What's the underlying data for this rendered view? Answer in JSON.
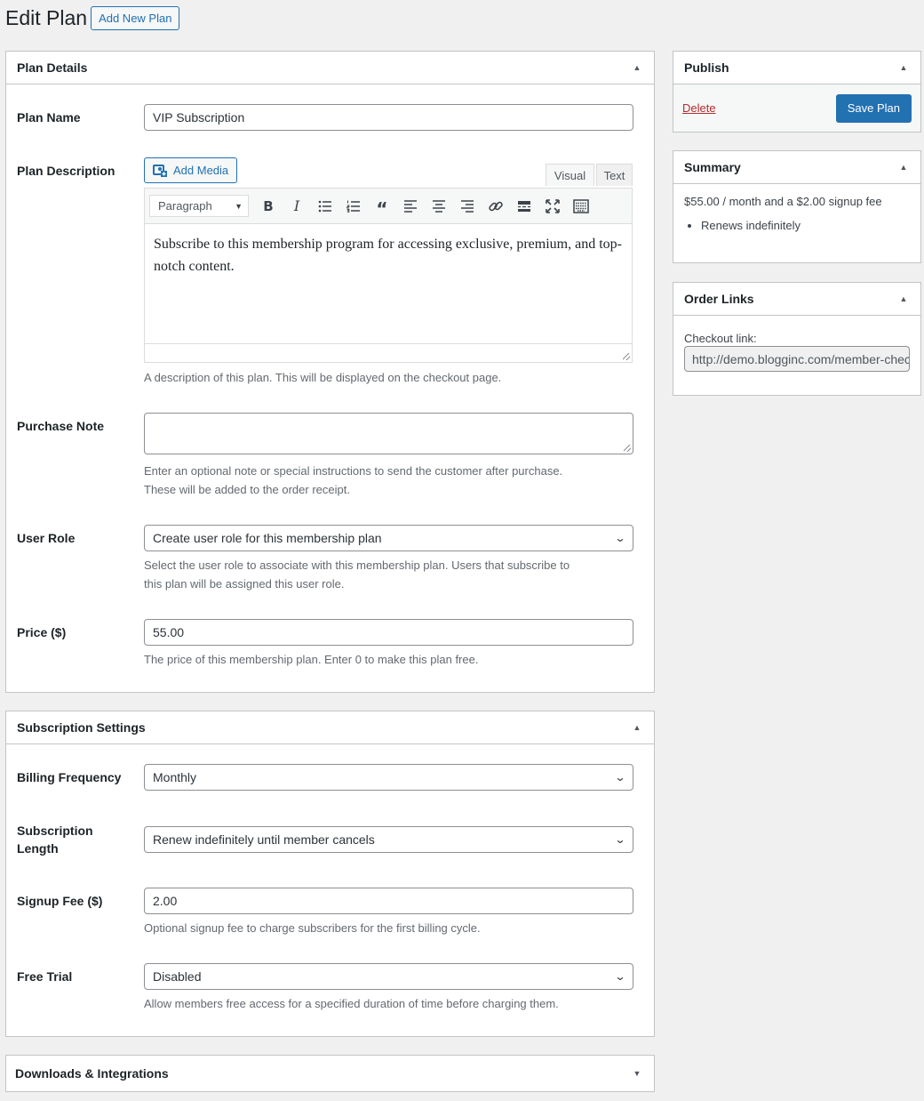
{
  "page": {
    "title": "Edit Plan",
    "add_new_label": "Add New Plan"
  },
  "plan_details": {
    "title": "Plan Details",
    "plan_name_label": "Plan Name",
    "plan_name_value": "VIP Subscription",
    "description_label": "Plan Description",
    "add_media_label": "Add Media",
    "tab_visual": "Visual",
    "tab_text": "Text",
    "format_value": "Paragraph",
    "description_content": "Subscribe to this membership program for accessing exclusive, premium, and top-notch content.",
    "description_help": "A description of this plan. This will be displayed on the checkout page.",
    "purchase_note_label": "Purchase Note",
    "purchase_note_value": "",
    "purchase_note_help_1": "Enter an optional note or special instructions to send the customer after purchase.",
    "purchase_note_help_2": "These will be added to the order receipt.",
    "user_role_label": "User Role",
    "user_role_value": "Create user role for this membership plan",
    "user_role_help_1": "Select the user role to associate with this membership plan. Users that subscribe to",
    "user_role_help_2": "this plan will be assigned this user role.",
    "price_label": "Price ($)",
    "price_value": "55.00",
    "price_help": "The price of this membership plan. Enter 0 to make this plan free."
  },
  "subscription_settings": {
    "title": "Subscription Settings",
    "billing_label": "Billing Frequency",
    "billing_value": "Monthly",
    "length_label_1": "Subscription",
    "length_label_2": "Length",
    "length_value": "Renew indefinitely until member cancels",
    "signup_label": "Signup Fee ($)",
    "signup_value": "2.00",
    "signup_help": "Optional signup fee to charge subscribers for the first billing cycle.",
    "trial_label": "Free Trial",
    "trial_value": "Disabled",
    "trial_help": "Allow members free access for a specified duration of time before charging them."
  },
  "downloads": {
    "title": "Downloads & Integrations"
  },
  "publish": {
    "title": "Publish",
    "delete_label": "Delete",
    "save_label": "Save Plan"
  },
  "summary": {
    "title": "Summary",
    "price_line": "$55.00 / month and a $2.00 signup fee",
    "bullets": [
      "Renews indefinitely"
    ]
  },
  "order_links": {
    "title": "Order Links",
    "checkout_label": "Checkout link:",
    "checkout_url": "http://demo.blogginc.com/member-checkout/"
  },
  "colors": {
    "accent": "#2271b1",
    "danger": "#b32d2e",
    "background": "#f0f0f1"
  }
}
